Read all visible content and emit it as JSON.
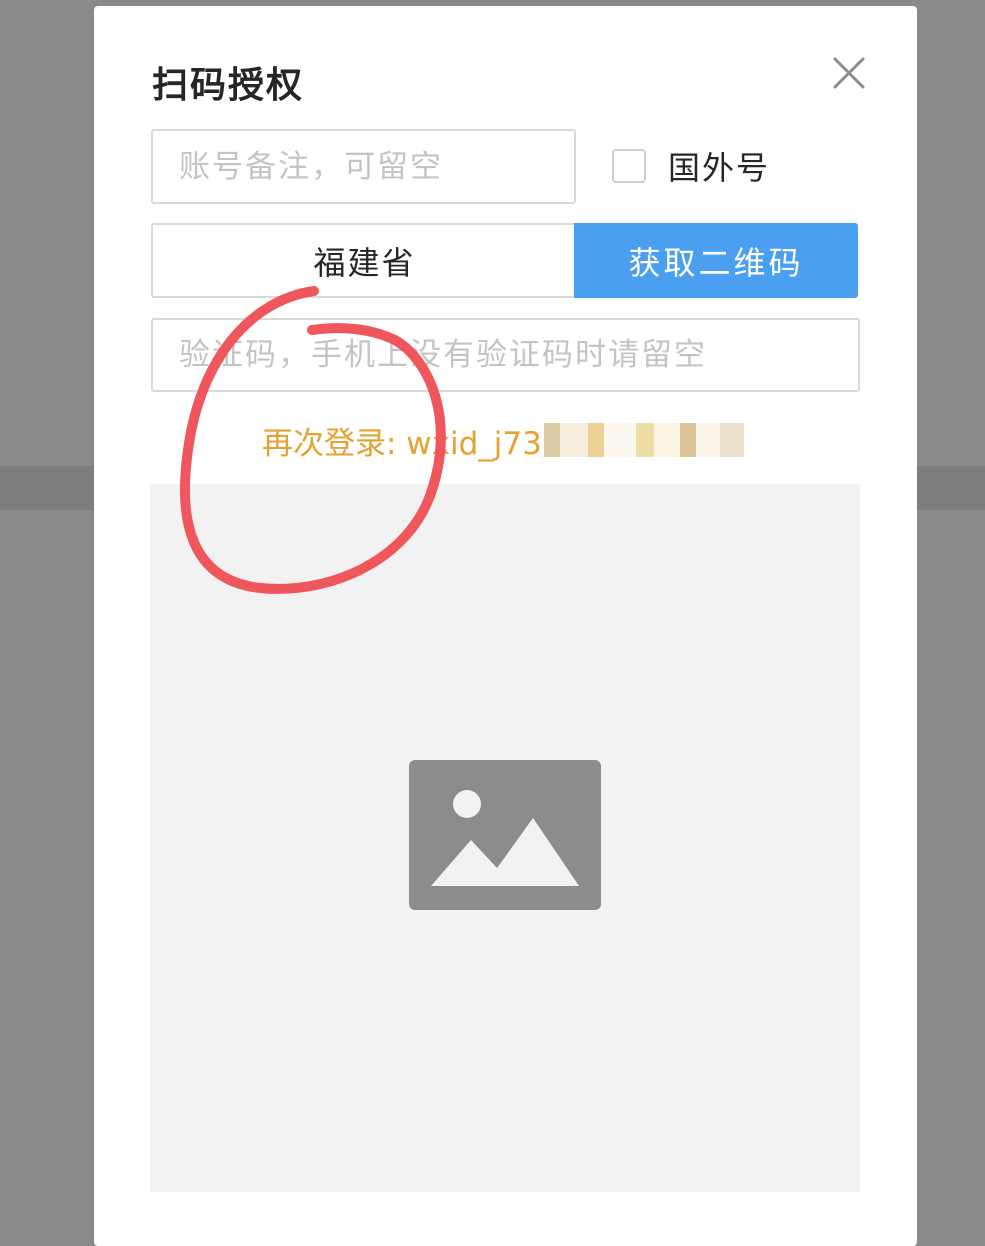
{
  "dialog": {
    "title": "扫码授权"
  },
  "remark_field": {
    "placeholder": "账号备注，可留空",
    "value": ""
  },
  "overseas_checkbox": {
    "label": "国外号",
    "checked": false
  },
  "province_select": {
    "selected": "福建省"
  },
  "qr_button": {
    "label": "获取二维码",
    "color": "#4a9ff0"
  },
  "code_field": {
    "placeholder": "验证码，手机上没有验证码时请留空",
    "value": ""
  },
  "relogin": {
    "text": "再次登录: wxid_j73",
    "color": "#e4a330"
  },
  "qr_area": {
    "icon": "image-placeholder-icon"
  },
  "annotation": {
    "color": "#f0575c"
  }
}
